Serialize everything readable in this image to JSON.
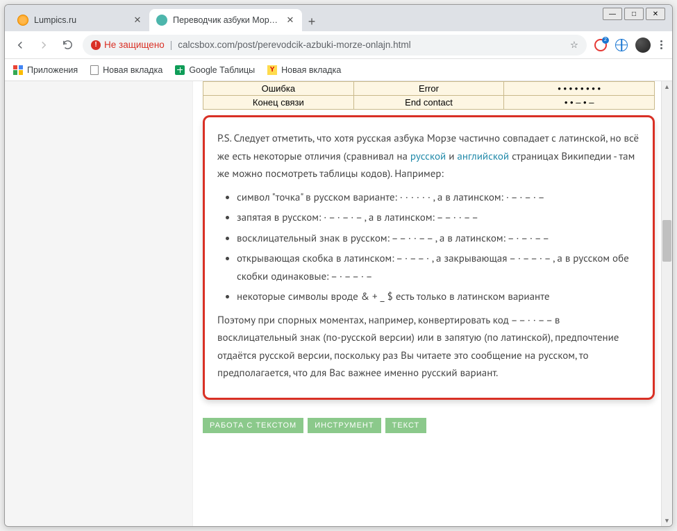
{
  "window": {
    "minimize": "—",
    "maximize": "□",
    "close": "✕"
  },
  "tabs": {
    "t0": {
      "title": "Lumpics.ru"
    },
    "t1": {
      "title": "Переводчик азбуки Морзе онл"
    },
    "new": "+",
    "close": "✕"
  },
  "toolbar": {
    "not_secure": "Не защищено",
    "url": "calcsbox.com/post/perevodcik-azbuki-morze-onlajn.html",
    "star": "☆"
  },
  "bookmarks": {
    "apps": "Приложения",
    "b1": "Новая вкладка",
    "b2": "Google Таблицы",
    "b3": "Новая вкладка"
  },
  "table": {
    "r0c0": "Ошибка",
    "r0c1": "Error",
    "r0c2": "• • • • • • • •",
    "r1c0": "Конец связи",
    "r1c1": "End contact",
    "r1c2": "• • – • –"
  },
  "content": {
    "p1a": "P.S. Следует отметить, что хотя русская азбука Морзе частично совпадает с латинской, но всё же есть некоторые отличия (сравнивал на ",
    "link_ru": "русской",
    "p1b": " и ",
    "link_en": "английской",
    "p1c": " страницах Википедии - там же можно посмотреть таблицы кодов). Например:",
    "li1": "символ \"точка\" в русском варианте: · · · · · · , а в латинском: · – · – · –",
    "li2": "запятая в русском: · – · – · – , а в латинском: – – · · – –",
    "li3": "восклицательный знак в русском: – – · · – – , а в латинском: – · – · – –",
    "li4": "открывающая скобка в латинском: – · – – · , а закрывающая – · – – · – , а в русском обе скобки одинаковые: – · – – · –",
    "li5": "некоторые символы вроде & + _ $ есть только в латинском варианте",
    "p2": "Поэтому при спорных моментах, например, конвертировать код – – · · – – в восклицательный знак (по-русской версии) или в запятую (по латинской), предпочтение отдаётся русской версии, поскольку раз Вы читаете это сообщение на русском, то предполагается, что для Вас важнее именно русский вариант."
  },
  "tags": {
    "t0": "Работа с текстом",
    "t1": "Инструмент",
    "t2": "Текст"
  }
}
